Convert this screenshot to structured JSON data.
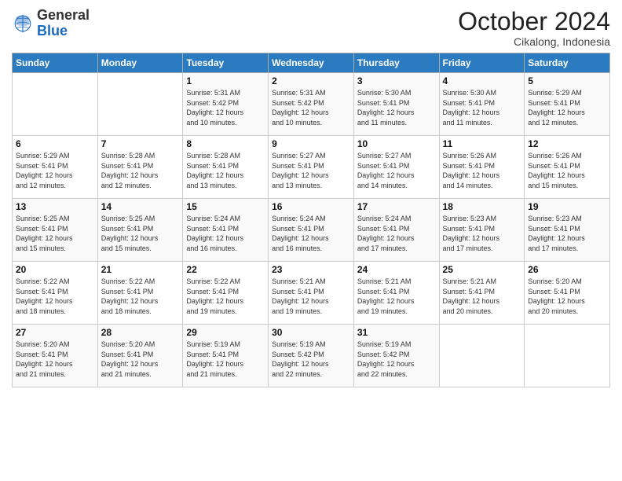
{
  "header": {
    "logo_general": "General",
    "logo_blue": "Blue",
    "month": "October 2024",
    "location": "Cikalong, Indonesia"
  },
  "columns": [
    "Sunday",
    "Monday",
    "Tuesday",
    "Wednesday",
    "Thursday",
    "Friday",
    "Saturday"
  ],
  "weeks": [
    [
      {
        "day": "",
        "info": ""
      },
      {
        "day": "",
        "info": ""
      },
      {
        "day": "1",
        "info": "Sunrise: 5:31 AM\nSunset: 5:42 PM\nDaylight: 12 hours\nand 10 minutes."
      },
      {
        "day": "2",
        "info": "Sunrise: 5:31 AM\nSunset: 5:42 PM\nDaylight: 12 hours\nand 10 minutes."
      },
      {
        "day": "3",
        "info": "Sunrise: 5:30 AM\nSunset: 5:41 PM\nDaylight: 12 hours\nand 11 minutes."
      },
      {
        "day": "4",
        "info": "Sunrise: 5:30 AM\nSunset: 5:41 PM\nDaylight: 12 hours\nand 11 minutes."
      },
      {
        "day": "5",
        "info": "Sunrise: 5:29 AM\nSunset: 5:41 PM\nDaylight: 12 hours\nand 12 minutes."
      }
    ],
    [
      {
        "day": "6",
        "info": "Sunrise: 5:29 AM\nSunset: 5:41 PM\nDaylight: 12 hours\nand 12 minutes."
      },
      {
        "day": "7",
        "info": "Sunrise: 5:28 AM\nSunset: 5:41 PM\nDaylight: 12 hours\nand 12 minutes."
      },
      {
        "day": "8",
        "info": "Sunrise: 5:28 AM\nSunset: 5:41 PM\nDaylight: 12 hours\nand 13 minutes."
      },
      {
        "day": "9",
        "info": "Sunrise: 5:27 AM\nSunset: 5:41 PM\nDaylight: 12 hours\nand 13 minutes."
      },
      {
        "day": "10",
        "info": "Sunrise: 5:27 AM\nSunset: 5:41 PM\nDaylight: 12 hours\nand 14 minutes."
      },
      {
        "day": "11",
        "info": "Sunrise: 5:26 AM\nSunset: 5:41 PM\nDaylight: 12 hours\nand 14 minutes."
      },
      {
        "day": "12",
        "info": "Sunrise: 5:26 AM\nSunset: 5:41 PM\nDaylight: 12 hours\nand 15 minutes."
      }
    ],
    [
      {
        "day": "13",
        "info": "Sunrise: 5:25 AM\nSunset: 5:41 PM\nDaylight: 12 hours\nand 15 minutes."
      },
      {
        "day": "14",
        "info": "Sunrise: 5:25 AM\nSunset: 5:41 PM\nDaylight: 12 hours\nand 15 minutes."
      },
      {
        "day": "15",
        "info": "Sunrise: 5:24 AM\nSunset: 5:41 PM\nDaylight: 12 hours\nand 16 minutes."
      },
      {
        "day": "16",
        "info": "Sunrise: 5:24 AM\nSunset: 5:41 PM\nDaylight: 12 hours\nand 16 minutes."
      },
      {
        "day": "17",
        "info": "Sunrise: 5:24 AM\nSunset: 5:41 PM\nDaylight: 12 hours\nand 17 minutes."
      },
      {
        "day": "18",
        "info": "Sunrise: 5:23 AM\nSunset: 5:41 PM\nDaylight: 12 hours\nand 17 minutes."
      },
      {
        "day": "19",
        "info": "Sunrise: 5:23 AM\nSunset: 5:41 PM\nDaylight: 12 hours\nand 17 minutes."
      }
    ],
    [
      {
        "day": "20",
        "info": "Sunrise: 5:22 AM\nSunset: 5:41 PM\nDaylight: 12 hours\nand 18 minutes."
      },
      {
        "day": "21",
        "info": "Sunrise: 5:22 AM\nSunset: 5:41 PM\nDaylight: 12 hours\nand 18 minutes."
      },
      {
        "day": "22",
        "info": "Sunrise: 5:22 AM\nSunset: 5:41 PM\nDaylight: 12 hours\nand 19 minutes."
      },
      {
        "day": "23",
        "info": "Sunrise: 5:21 AM\nSunset: 5:41 PM\nDaylight: 12 hours\nand 19 minutes."
      },
      {
        "day": "24",
        "info": "Sunrise: 5:21 AM\nSunset: 5:41 PM\nDaylight: 12 hours\nand 19 minutes."
      },
      {
        "day": "25",
        "info": "Sunrise: 5:21 AM\nSunset: 5:41 PM\nDaylight: 12 hours\nand 20 minutes."
      },
      {
        "day": "26",
        "info": "Sunrise: 5:20 AM\nSunset: 5:41 PM\nDaylight: 12 hours\nand 20 minutes."
      }
    ],
    [
      {
        "day": "27",
        "info": "Sunrise: 5:20 AM\nSunset: 5:41 PM\nDaylight: 12 hours\nand 21 minutes."
      },
      {
        "day": "28",
        "info": "Sunrise: 5:20 AM\nSunset: 5:41 PM\nDaylight: 12 hours\nand 21 minutes."
      },
      {
        "day": "29",
        "info": "Sunrise: 5:19 AM\nSunset: 5:41 PM\nDaylight: 12 hours\nand 21 minutes."
      },
      {
        "day": "30",
        "info": "Sunrise: 5:19 AM\nSunset: 5:42 PM\nDaylight: 12 hours\nand 22 minutes."
      },
      {
        "day": "31",
        "info": "Sunrise: 5:19 AM\nSunset: 5:42 PM\nDaylight: 12 hours\nand 22 minutes."
      },
      {
        "day": "",
        "info": ""
      },
      {
        "day": "",
        "info": ""
      }
    ]
  ]
}
